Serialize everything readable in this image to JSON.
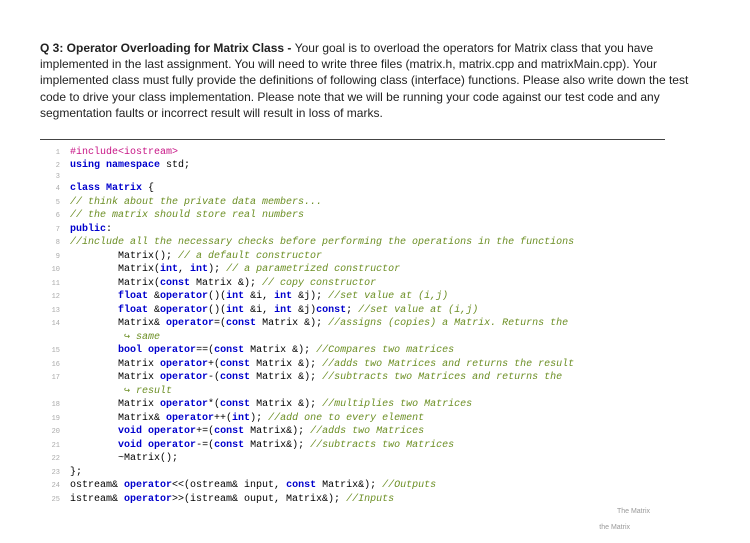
{
  "question": {
    "title": "Q 3: Operator Overloading for Matrix Class - ",
    "body": "Your goal is to overload the operators for Matrix class that you have implemented in the last assignment. You will need to write three files (matrix.h, matrix.cpp and matrixMain.cpp). Your implemented class must fully provide the definitions of following class (interface) functions. Please also write down the test code to drive your class implementation. Please note that we will be running your code against our test code and any segmentation faults or incorrect result will result in loss of marks."
  },
  "code": {
    "lines": [
      {
        "n": "1",
        "html": "<span class='pp'>#include&lt;iostream&gt;</span>"
      },
      {
        "n": "2",
        "html": "<span class='kw'>using namespace</span> std;"
      },
      {
        "n": "3",
        "html": ""
      },
      {
        "n": "4",
        "html": "<span class='kw'>class</span> <span class='kw'>Matrix</span> {"
      },
      {
        "n": "5",
        "html": "<span class='cm'>// think about the private data members...</span>"
      },
      {
        "n": "6",
        "html": "<span class='cm'>// the matrix should store real numbers</span>"
      },
      {
        "n": "7",
        "html": "<span class='kw'>public</span>:"
      },
      {
        "n": "8",
        "html": "<span class='cm'>//include all the necessary checks before performing the operations in the functions</span>"
      },
      {
        "n": "9",
        "html": "        Matrix(); <span class='cm'>// a default constructor</span>"
      },
      {
        "n": "10",
        "html": "        Matrix(<span class='kw'>int</span>, <span class='kw'>int</span>); <span class='cm'>// a parametrized constructor</span>"
      },
      {
        "n": "11",
        "html": "        Matrix(<span class='kw'>const</span> Matrix &amp;); <span class='cm'>// copy constructor</span>"
      },
      {
        "n": "12",
        "html": "        <span class='kw'>float</span> &amp;<span class='kw'>operator</span>()(<span class='kw'>int</span> &amp;i, <span class='kw'>int</span> &amp;j); <span class='cm'>//set value at (i,j)</span>"
      },
      {
        "n": "13",
        "html": "        <span class='kw'>float</span> &amp;<span class='kw'>operator</span>()(<span class='kw'>int</span> &amp;i, <span class='kw'>int</span> &amp;j)<span class='kw'>const</span>; <span class='cm'>//set value at (i,j)</span>"
      },
      {
        "n": "14",
        "html": "        Matrix&amp; <span class='kw'>operator</span>=(<span class='kw'>const</span> Matrix &amp;); <span class='cm'>//assigns (copies) a Matrix. Returns the</span>"
      },
      {
        "n": "",
        "html": "         <span class='cm'>↪ same</span>"
      },
      {
        "n": "15",
        "html": "        <span class='kw'>bool</span> <span class='kw'>operator</span>==(<span class='kw'>const</span> Matrix &amp;); <span class='cm'>//Compares two matrices</span>"
      },
      {
        "n": "16",
        "html": "        Matrix <span class='kw'>operator</span>+(<span class='kw'>const</span> Matrix &amp;); <span class='cm'>//adds two Matrices and returns the result</span>"
      },
      {
        "n": "17",
        "html": "        Matrix <span class='kw'>operator</span>-(<span class='kw'>const</span> Matrix &amp;); <span class='cm'>//subtracts two Matrices and returns the</span>"
      },
      {
        "n": "",
        "html": "         <span class='cm'>↪ result</span>"
      },
      {
        "n": "18",
        "html": "        Matrix <span class='kw'>operator</span>*(<span class='kw'>const</span> Matrix &amp;); <span class='cm'>//multiplies two Matrices</span>"
      },
      {
        "n": "19",
        "html": "        Matrix&amp; <span class='kw'>operator</span>++(<span class='kw'>int</span>); <span class='cm'>//add one to every element</span>"
      },
      {
        "n": "20",
        "html": "        <span class='kw'>void</span> <span class='kw'>operator</span>+=(<span class='kw'>const</span> Matrix&amp;); <span class='cm'>//adds two Matrices</span>"
      },
      {
        "n": "21",
        "html": "        <span class='kw'>void</span> <span class='kw'>operator</span>-=(<span class='kw'>const</span> Matrix&amp;); <span class='cm'>//subtracts two Matrices</span>"
      },
      {
        "n": "22",
        "html": "        ~Matrix();"
      },
      {
        "n": "23",
        "html": "};"
      },
      {
        "n": "24",
        "html": "ostream&amp; <span class='kw'>operator</span>&lt;&lt;(ostream&amp; input, <span class='kw'>const</span> Matrix&amp;); <span class='cm'>//Outputs</span>"
      },
      {
        "n": "25",
        "html": "istream&amp; <span class='kw'>operator</span>&gt;&gt;(istream&amp; ouput, Matrix&amp;); <span class='cm'>//Inputs</span>"
      }
    ]
  },
  "watermarks": {
    "wm1": "The Matrix",
    "wm2": "the Matrix"
  }
}
